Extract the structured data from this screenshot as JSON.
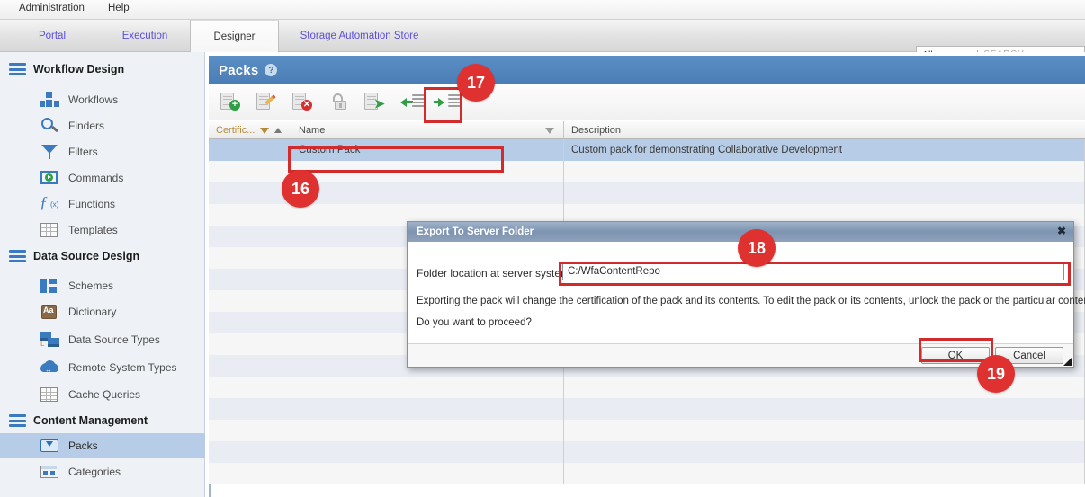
{
  "menubar": {
    "items": [
      {
        "label": "Administration"
      },
      {
        "label": "Help"
      }
    ]
  },
  "tabs": [
    {
      "label": "Portal",
      "active": false
    },
    {
      "label": "Execution",
      "active": false
    },
    {
      "label": "Designer",
      "active": true
    },
    {
      "label": "Storage Automation Store",
      "active": false
    }
  ],
  "search": {
    "scope": "All",
    "placeholder": "SEARCH",
    "divider": "|"
  },
  "sidebar": {
    "sections": [
      {
        "title": "Workflow Design",
        "items": [
          {
            "label": "Workflows",
            "icon": "workflows-icon"
          },
          {
            "label": "Finders",
            "icon": "finders-icon"
          },
          {
            "label": "Filters",
            "icon": "filters-icon"
          },
          {
            "label": "Commands",
            "icon": "commands-icon"
          },
          {
            "label": "Functions",
            "icon": "functions-icon"
          },
          {
            "label": "Templates",
            "icon": "templates-icon"
          }
        ]
      },
      {
        "title": "Data Source Design",
        "items": [
          {
            "label": "Schemes",
            "icon": "schemes-icon"
          },
          {
            "label": "Dictionary",
            "icon": "dictionary-icon"
          },
          {
            "label": "Data Source Types",
            "icon": "data-source-types-icon"
          },
          {
            "label": "Remote System Types",
            "icon": "remote-system-types-icon"
          },
          {
            "label": "Cache Queries",
            "icon": "cache-queries-icon"
          }
        ]
      },
      {
        "title": "Content Management",
        "items": [
          {
            "label": "Packs",
            "icon": "packs-icon",
            "selected": true
          },
          {
            "label": "Categories",
            "icon": "categories-icon"
          }
        ]
      }
    ]
  },
  "panel": {
    "title": "Packs",
    "help_glyph": "?"
  },
  "toolbar": {
    "buttons": [
      {
        "name": "new-pack",
        "title": "New"
      },
      {
        "name": "edit-pack",
        "title": "Edit"
      },
      {
        "name": "delete-pack",
        "title": "Delete"
      },
      {
        "name": "unlock-pack",
        "title": "Unlock"
      },
      {
        "name": "export-pack",
        "title": "Export"
      },
      {
        "name": "import-from-server",
        "title": "Import From Server Folder"
      },
      {
        "name": "export-to-server",
        "title": "Export To Server Folder",
        "highlighted": true
      }
    ]
  },
  "table": {
    "columns": [
      {
        "key": "certification",
        "label": "Certific...",
        "has_filter": true,
        "sorted": true
      },
      {
        "key": "name",
        "label": "Name",
        "has_filter": true,
        "sorted": false
      },
      {
        "key": "description",
        "label": "Description",
        "has_filter": false,
        "sorted": false
      }
    ],
    "rows": [
      {
        "certification": "",
        "name": "Custom Pack",
        "description": "Custom pack for demonstrating Collaborative Development",
        "selected": true
      }
    ]
  },
  "dialog": {
    "title": "Export To Server Folder",
    "close_glyph": "✖",
    "field_label": "Folder location at server system:",
    "field_value": "C:/WfaContentRepo",
    "message_line_1": "Exporting the pack will change the certification of the pack and its contents. To edit the pack or its contents, unlock the pack or the particular content.",
    "message_line_2": "Do you want to proceed?",
    "ok_label": "OK",
    "cancel_label": "Cancel"
  },
  "annotations": {
    "badges": [
      {
        "id": "16",
        "label": "16"
      },
      {
        "id": "17",
        "label": "17"
      },
      {
        "id": "18",
        "label": "18"
      },
      {
        "id": "19",
        "label": "19"
      }
    ],
    "accent_color": "#e03131",
    "highlight_border_color": "#d22b2b"
  }
}
